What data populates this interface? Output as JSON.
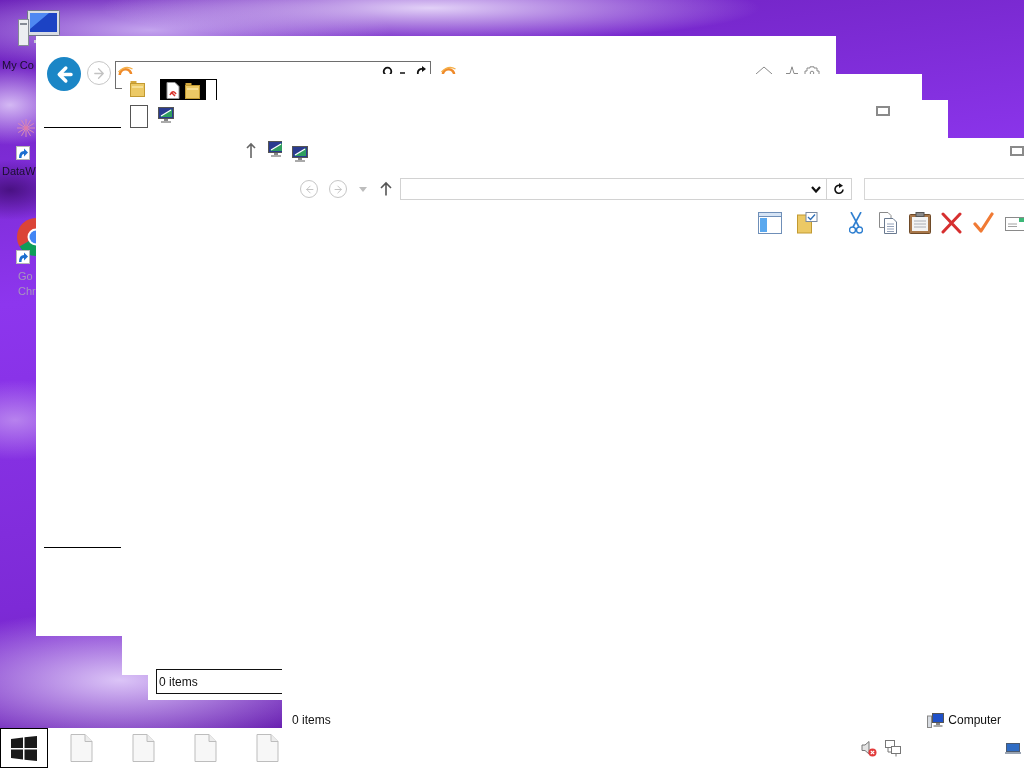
{
  "desktop": {
    "icons": [
      {
        "kind": "computer",
        "label": "My Co",
        "dimmed": false
      },
      {
        "kind": "app",
        "label": "DataW",
        "dimmed": false
      },
      {
        "kind": "browser",
        "label": "Go Chr",
        "dimmed": true
      }
    ]
  },
  "windows": [
    {
      "kind": "browser",
      "nav": [
        {
          "kind": "back",
          "disabled": false
        },
        {
          "kind": "forward",
          "disabled": true
        }
      ]
    },
    {
      "kind": "folder"
    },
    {
      "kind": "explorer-stub",
      "status": "0 items"
    },
    {
      "kind": "explorer",
      "nav": [
        {
          "kind": "back",
          "disabled": true
        },
        {
          "kind": "forward",
          "disabled": true
        },
        {
          "kind": "up",
          "disabled": false
        }
      ],
      "status": "0 items",
      "location": "Computer"
    }
  ],
  "taskbar": {
    "volume": {
      "muted": true
    }
  }
}
